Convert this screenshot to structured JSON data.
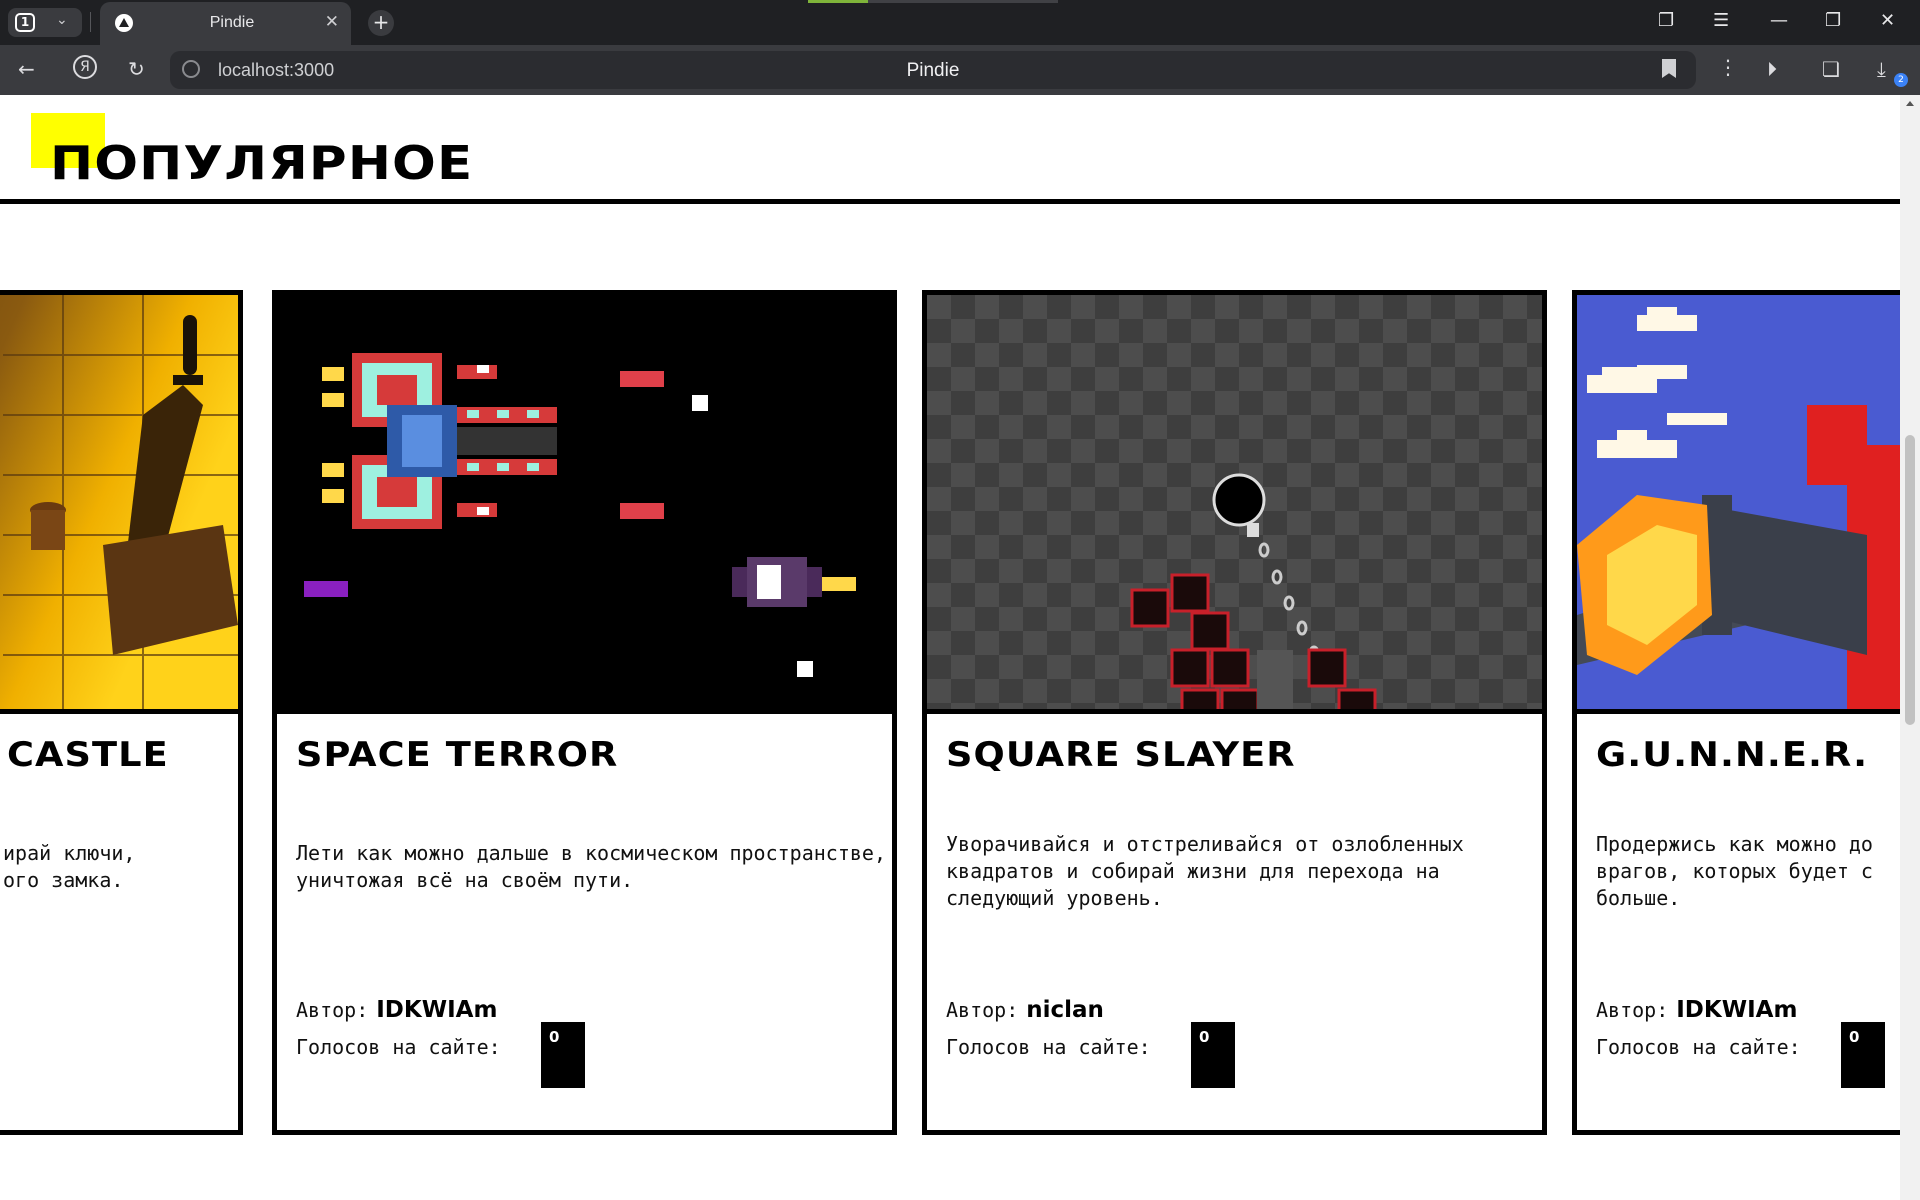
{
  "browser": {
    "tab_count": "1",
    "tab_title": "Pindie",
    "url": "localhost:3000",
    "page_title": "Pindie",
    "downloads_badge": "2"
  },
  "page": {
    "section_title": "ПОПУЛЯРНОЕ",
    "cards": [
      {
        "title": "CASTLE",
        "description_lines": [
          "ирай ключи,",
          "ого замка."
        ],
        "author_label": "",
        "author": "",
        "votes_label": "",
        "votes": ""
      },
      {
        "title": "SPACE TERROR",
        "description": "Лети как можно дальше в космическом пространстве, уничтожая всё на своём пути.",
        "author_label": "Автор:",
        "author": "IDKWIAm",
        "votes_label": "Голосов на сайте:",
        "votes": "0"
      },
      {
        "title": "SQUARE SLAYER",
        "description": "Уворачивайся и отстреливайся от озлобленных квадратов и собирай жизни для перехода на следующий уровень.",
        "author_label": "Автор:",
        "author": "niclan",
        "votes_label": "Голосов на сайте:",
        "votes": "0"
      },
      {
        "title": "G.U.N.N.E.R.",
        "description": "Продержись как можно до врагов, которых будет с больше.",
        "author_label": "Автор:",
        "author": "IDKWIAm",
        "votes_label": "Голосов на сайте:",
        "votes": "0"
      }
    ]
  },
  "colors": {
    "accent_yellow": "#ffff00",
    "chrome_dark": "#1f2023",
    "chrome_mid": "#3a3b3f",
    "space_bg": "#000000",
    "gunner_sky": "#4a5bd1"
  }
}
